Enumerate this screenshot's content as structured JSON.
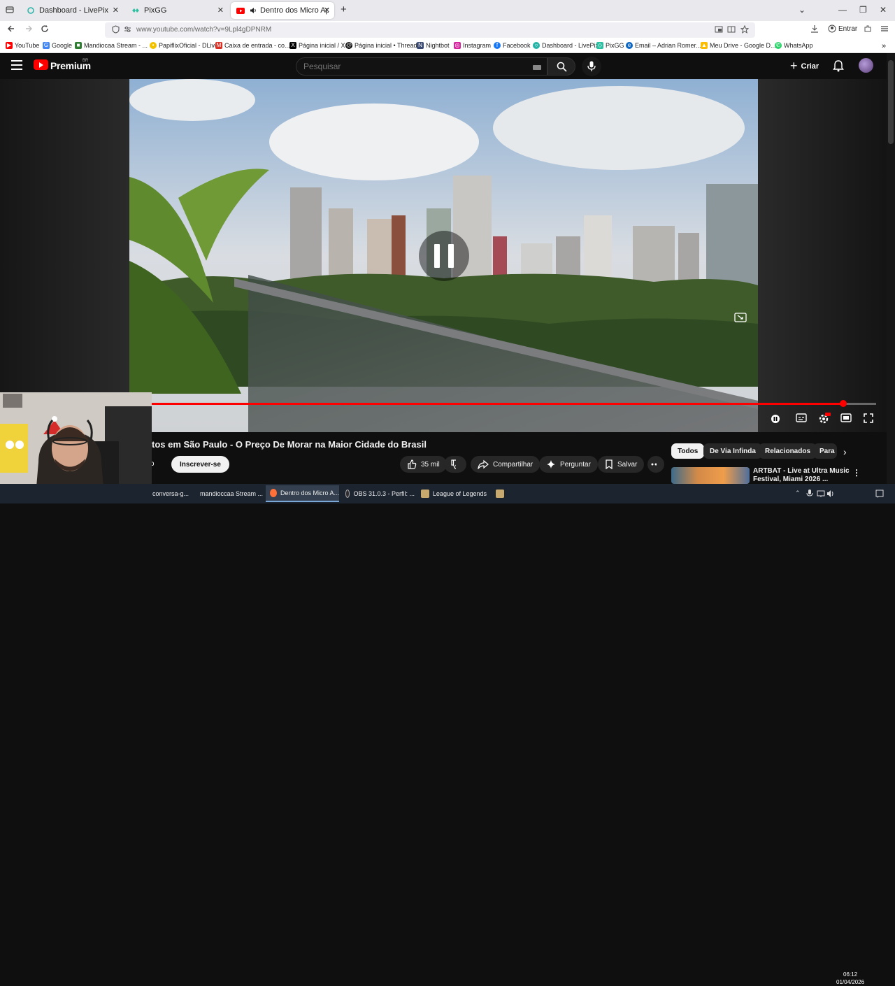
{
  "browser": {
    "tabs": [
      {
        "title": "Dashboard - LivePix",
        "icon": "livepix-icon",
        "active": false
      },
      {
        "title": "PixGG",
        "icon": "pixgg-icon",
        "active": false
      },
      {
        "title": "Dentro dos Micro Apartam",
        "icon": "youtube-icon",
        "active": true
      }
    ],
    "url": "www.youtube.com/watch?v=9Lpl4gDPNRM",
    "signin_label": "Entrar",
    "bookmarks": [
      {
        "label": "YouTube",
        "color": "#ff0000"
      },
      {
        "label": "Google",
        "color": "#4285f4"
      },
      {
        "label": "Mandiocaa Stream - ...",
        "color": "#2f7d32"
      },
      {
        "label": "PapiflixOficial - DLive",
        "color": "#f2c200"
      },
      {
        "label": "Caixa de entrada - co...",
        "color": "#d93025"
      },
      {
        "label": "Página inicial / X",
        "color": "#000000"
      },
      {
        "label": "Página inicial • Threads",
        "color": "#000000"
      },
      {
        "label": "Nightbot",
        "color": "#3b4a73"
      },
      {
        "label": "Instagram",
        "color": "#d6249f"
      },
      {
        "label": "Facebook",
        "color": "#1877f2"
      },
      {
        "label": "Dashboard - LivePix",
        "color": "#27b3a6"
      },
      {
        "label": "PixGG",
        "color": "#2cc0a3"
      },
      {
        "label": "Email – Adrian Romer...",
        "color": "#0a66c2"
      },
      {
        "label": "Meu Drive - Google D...",
        "color": "#fbbc04"
      },
      {
        "label": "WhatsApp",
        "color": "#25d366"
      }
    ]
  },
  "youtube": {
    "brand": "Premium",
    "region": "BR",
    "search_placeholder": "Pesquisar",
    "create_label": "Criar",
    "video": {
      "title": "tos em São Paulo - O Preço De Morar na Maior Cidade do Brasil",
      "progress": 0.955
    },
    "actions": {
      "member_label": "bro",
      "subscribe_label": "Inscrever-se",
      "likes": "35 mil",
      "share_label": "Compartilhar",
      "ask_label": "Perguntar",
      "save_label": "Salvar"
    },
    "chips": [
      "Todos",
      "De Via Infinda",
      "Relacionados",
      "Para"
    ],
    "recommendation": {
      "title": "ARTBAT - Live at Ultra Music Festival, Miami 2026 ..."
    },
    "settings_badge": "HD"
  },
  "taskbar": {
    "items": [
      {
        "label": "conversa-g...",
        "color": "#6d6d6d"
      },
      {
        "label": "mandioccaa Stream ...",
        "color": "#ff7139"
      },
      {
        "label": "Dentro dos Micro A...",
        "color": "#ff7139"
      },
      {
        "label": "OBS 31.0.3 - Perfil: ...",
        "color": "#302e31"
      },
      {
        "label": "League of Legends",
        "color": "#c8aa6e"
      }
    ],
    "time": "06:12",
    "date": "01/04/2026"
  }
}
